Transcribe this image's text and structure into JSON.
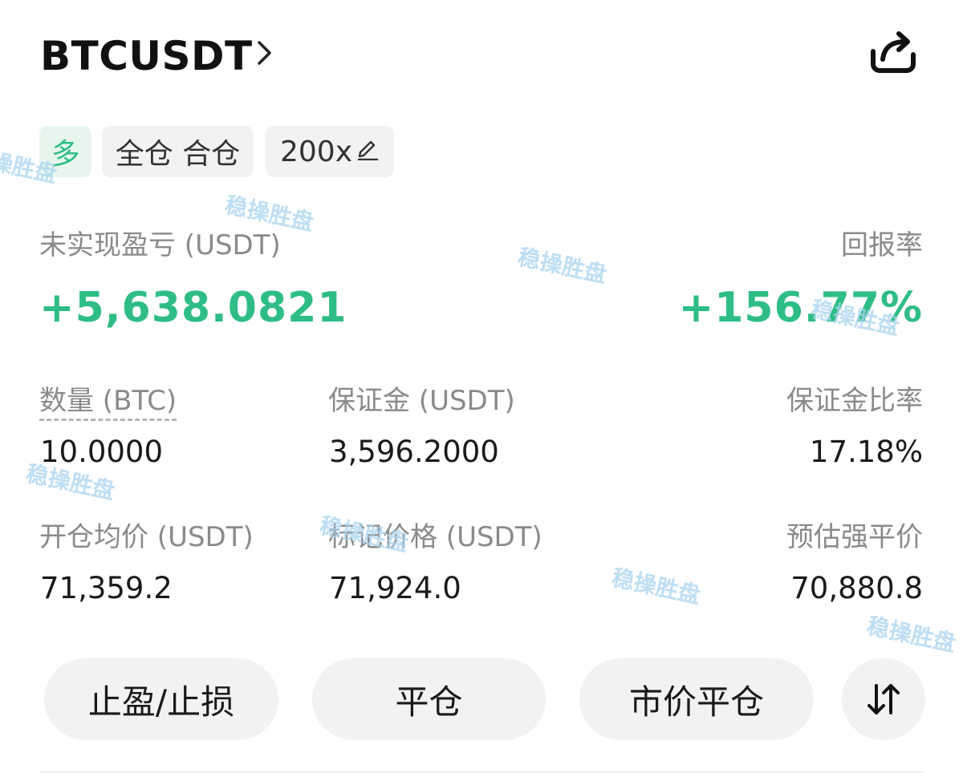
{
  "header": {
    "symbol": "BTCUSDT"
  },
  "tags": {
    "side": "多",
    "margin_mode": "全仓 合仓",
    "leverage": "200x"
  },
  "pnl": {
    "label": "未实现盈亏 (USDT)",
    "value": "+5,638.0821",
    "roe_label": "回报率",
    "roe_value": "+156.77%"
  },
  "stats": {
    "quantity_label": "数量 (BTC)",
    "quantity_value": "10.0000",
    "margin_label": "保证金 (USDT)",
    "margin_value": "3,596.2000",
    "margin_ratio_label": "保证金比率",
    "margin_ratio_value": "17.18%",
    "entry_price_label": "开仓均价 (USDT)",
    "entry_price_value": "71,359.2",
    "mark_price_label": "标记价格 (USDT)",
    "mark_price_value": "71,924.0",
    "liq_price_label": "预估强平价",
    "liq_price_value": "70,880.8"
  },
  "actions": {
    "tpsl": "止盈/止损",
    "close": "平仓",
    "market_close": "市价平仓"
  },
  "watermark": "稳操胜盘",
  "icons": {
    "chevron": "chevron-right-icon",
    "share": "share-icon",
    "edit": "pencil-icon",
    "sort": "sort-arrows-icon"
  },
  "colors": {
    "profit_green": "#2ebd85",
    "button_bg": "#f2f2f2",
    "label_gray": "#8a8a8a"
  }
}
